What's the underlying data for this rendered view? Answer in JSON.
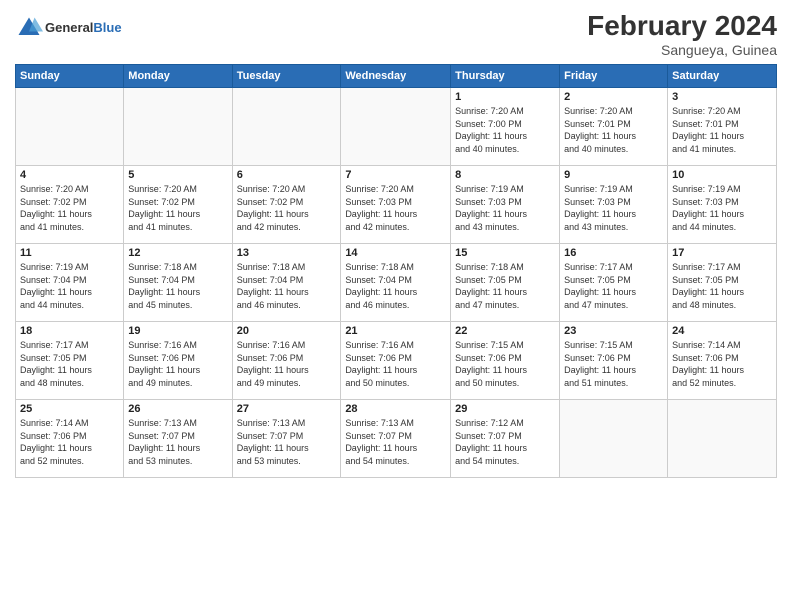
{
  "logo": {
    "text_general": "General",
    "text_blue": "Blue"
  },
  "title": "February 2024",
  "subtitle": "Sangueya, Guinea",
  "days_of_week": [
    "Sunday",
    "Monday",
    "Tuesday",
    "Wednesday",
    "Thursday",
    "Friday",
    "Saturday"
  ],
  "weeks": [
    [
      {
        "day": "",
        "info": ""
      },
      {
        "day": "",
        "info": ""
      },
      {
        "day": "",
        "info": ""
      },
      {
        "day": "",
        "info": ""
      },
      {
        "day": "1",
        "info": "Sunrise: 7:20 AM\nSunset: 7:00 PM\nDaylight: 11 hours\nand 40 minutes."
      },
      {
        "day": "2",
        "info": "Sunrise: 7:20 AM\nSunset: 7:01 PM\nDaylight: 11 hours\nand 40 minutes."
      },
      {
        "day": "3",
        "info": "Sunrise: 7:20 AM\nSunset: 7:01 PM\nDaylight: 11 hours\nand 41 minutes."
      }
    ],
    [
      {
        "day": "4",
        "info": "Sunrise: 7:20 AM\nSunset: 7:02 PM\nDaylight: 11 hours\nand 41 minutes."
      },
      {
        "day": "5",
        "info": "Sunrise: 7:20 AM\nSunset: 7:02 PM\nDaylight: 11 hours\nand 41 minutes."
      },
      {
        "day": "6",
        "info": "Sunrise: 7:20 AM\nSunset: 7:02 PM\nDaylight: 11 hours\nand 42 minutes."
      },
      {
        "day": "7",
        "info": "Sunrise: 7:20 AM\nSunset: 7:03 PM\nDaylight: 11 hours\nand 42 minutes."
      },
      {
        "day": "8",
        "info": "Sunrise: 7:19 AM\nSunset: 7:03 PM\nDaylight: 11 hours\nand 43 minutes."
      },
      {
        "day": "9",
        "info": "Sunrise: 7:19 AM\nSunset: 7:03 PM\nDaylight: 11 hours\nand 43 minutes."
      },
      {
        "day": "10",
        "info": "Sunrise: 7:19 AM\nSunset: 7:03 PM\nDaylight: 11 hours\nand 44 minutes."
      }
    ],
    [
      {
        "day": "11",
        "info": "Sunrise: 7:19 AM\nSunset: 7:04 PM\nDaylight: 11 hours\nand 44 minutes."
      },
      {
        "day": "12",
        "info": "Sunrise: 7:18 AM\nSunset: 7:04 PM\nDaylight: 11 hours\nand 45 minutes."
      },
      {
        "day": "13",
        "info": "Sunrise: 7:18 AM\nSunset: 7:04 PM\nDaylight: 11 hours\nand 46 minutes."
      },
      {
        "day": "14",
        "info": "Sunrise: 7:18 AM\nSunset: 7:04 PM\nDaylight: 11 hours\nand 46 minutes."
      },
      {
        "day": "15",
        "info": "Sunrise: 7:18 AM\nSunset: 7:05 PM\nDaylight: 11 hours\nand 47 minutes."
      },
      {
        "day": "16",
        "info": "Sunrise: 7:17 AM\nSunset: 7:05 PM\nDaylight: 11 hours\nand 47 minutes."
      },
      {
        "day": "17",
        "info": "Sunrise: 7:17 AM\nSunset: 7:05 PM\nDaylight: 11 hours\nand 48 minutes."
      }
    ],
    [
      {
        "day": "18",
        "info": "Sunrise: 7:17 AM\nSunset: 7:05 PM\nDaylight: 11 hours\nand 48 minutes."
      },
      {
        "day": "19",
        "info": "Sunrise: 7:16 AM\nSunset: 7:06 PM\nDaylight: 11 hours\nand 49 minutes."
      },
      {
        "day": "20",
        "info": "Sunrise: 7:16 AM\nSunset: 7:06 PM\nDaylight: 11 hours\nand 49 minutes."
      },
      {
        "day": "21",
        "info": "Sunrise: 7:16 AM\nSunset: 7:06 PM\nDaylight: 11 hours\nand 50 minutes."
      },
      {
        "day": "22",
        "info": "Sunrise: 7:15 AM\nSunset: 7:06 PM\nDaylight: 11 hours\nand 50 minutes."
      },
      {
        "day": "23",
        "info": "Sunrise: 7:15 AM\nSunset: 7:06 PM\nDaylight: 11 hours\nand 51 minutes."
      },
      {
        "day": "24",
        "info": "Sunrise: 7:14 AM\nSunset: 7:06 PM\nDaylight: 11 hours\nand 52 minutes."
      }
    ],
    [
      {
        "day": "25",
        "info": "Sunrise: 7:14 AM\nSunset: 7:06 PM\nDaylight: 11 hours\nand 52 minutes."
      },
      {
        "day": "26",
        "info": "Sunrise: 7:13 AM\nSunset: 7:07 PM\nDaylight: 11 hours\nand 53 minutes."
      },
      {
        "day": "27",
        "info": "Sunrise: 7:13 AM\nSunset: 7:07 PM\nDaylight: 11 hours\nand 53 minutes."
      },
      {
        "day": "28",
        "info": "Sunrise: 7:13 AM\nSunset: 7:07 PM\nDaylight: 11 hours\nand 54 minutes."
      },
      {
        "day": "29",
        "info": "Sunrise: 7:12 AM\nSunset: 7:07 PM\nDaylight: 11 hours\nand 54 minutes."
      },
      {
        "day": "",
        "info": ""
      },
      {
        "day": "",
        "info": ""
      }
    ]
  ]
}
